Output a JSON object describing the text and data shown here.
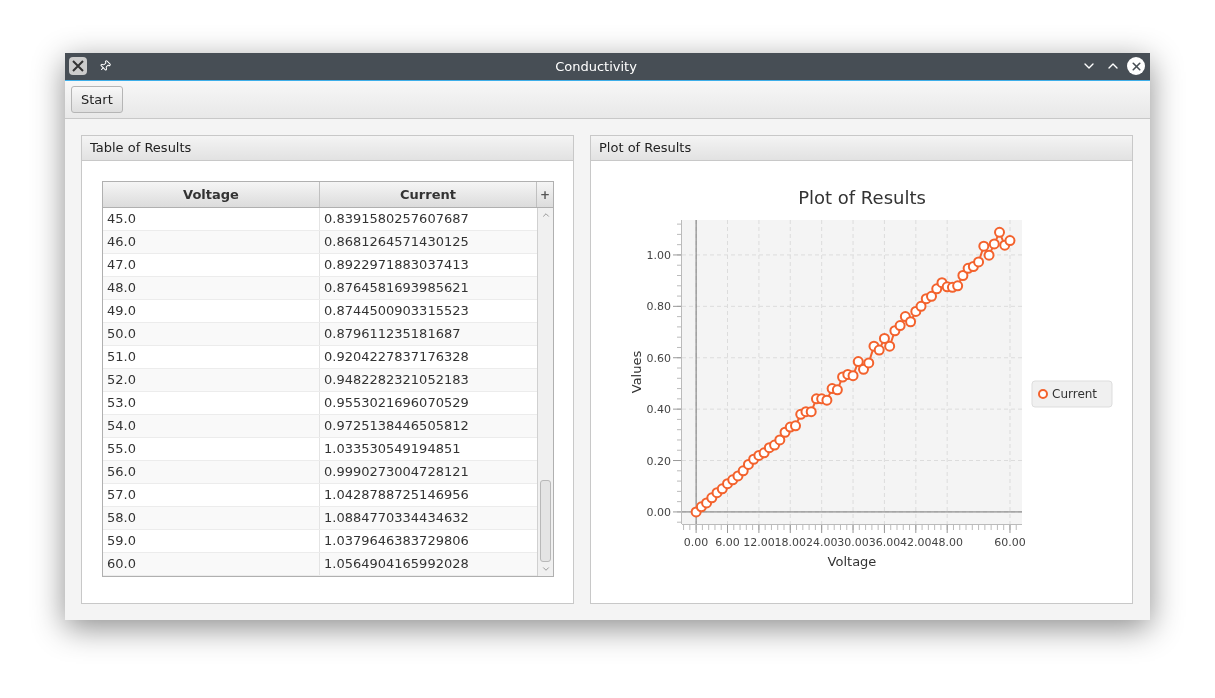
{
  "window": {
    "title": "Conductivity"
  },
  "toolbar": {
    "buttons": [
      "Start"
    ]
  },
  "table_panel": {
    "title": "Table of Results",
    "columns": [
      "Voltage",
      "Current"
    ],
    "column_menu": "+",
    "rows": [
      [
        "45.0",
        "0.8391580257607687"
      ],
      [
        "46.0",
        "0.8681264571430125"
      ],
      [
        "47.0",
        "0.8922971883037413"
      ],
      [
        "48.0",
        "0.8764581693985621"
      ],
      [
        "49.0",
        "0.8744500903315523"
      ],
      [
        "50.0",
        "0.879611235181687"
      ],
      [
        "51.0",
        "0.9204227837176328"
      ],
      [
        "52.0",
        "0.9482282321052183"
      ],
      [
        "53.0",
        "0.9553021696070529"
      ],
      [
        "54.0",
        "0.9725138446505812"
      ],
      [
        "55.0",
        "1.033530549194851"
      ],
      [
        "56.0",
        "0.9990273004728121"
      ],
      [
        "57.0",
        "1.0428788725146956"
      ],
      [
        "58.0",
        "1.0884770334434632"
      ],
      [
        "59.0",
        "1.0379646383729806"
      ],
      [
        "60.0",
        "1.0564904165992028"
      ]
    ]
  },
  "plot_panel": {
    "title": "Plot of Results",
    "chart_data": {
      "type": "line",
      "title": "Plot of Results",
      "xlabel": "Voltage",
      "ylabel": "Values",
      "x": [
        0,
        1,
        2,
        3,
        4,
        5,
        6,
        7,
        8,
        9,
        10,
        11,
        12,
        13,
        14,
        15,
        16,
        17,
        18,
        19,
        20,
        21,
        22,
        23,
        24,
        25,
        26,
        27,
        28,
        29,
        30,
        31,
        32,
        33,
        34,
        35,
        36,
        37,
        38,
        39,
        40,
        41,
        42,
        43,
        44,
        45,
        46,
        47,
        48,
        49,
        50,
        51,
        52,
        53,
        54,
        55,
        56,
        57,
        58,
        59,
        60
      ],
      "grid": true,
      "series": [
        {
          "name": "Current",
          "color": "#f3622d",
          "marker": "circle",
          "values": [
            0.0,
            0.02,
            0.035,
            0.055,
            0.075,
            0.09,
            0.11,
            0.125,
            0.14,
            0.16,
            0.185,
            0.205,
            0.22,
            0.23,
            0.25,
            0.26,
            0.28,
            0.31,
            0.33,
            0.335,
            0.38,
            0.39,
            0.39,
            0.44,
            0.44,
            0.435,
            0.48,
            0.475,
            0.525,
            0.535,
            0.53,
            0.585,
            0.555,
            0.58,
            0.645,
            0.63,
            0.675,
            0.645,
            0.705,
            0.725,
            0.76,
            0.74,
            0.78,
            0.8,
            0.83,
            0.839,
            0.868,
            0.892,
            0.876,
            0.874,
            0.88,
            0.92,
            0.948,
            0.955,
            0.973,
            1.034,
            0.999,
            1.043,
            1.088,
            1.038,
            1.056
          ]
        }
      ],
      "xlim": [
        -2.7,
        62.3
      ],
      "ylim": [
        -0.047,
        1.136
      ],
      "xticks": [
        {
          "value": 0,
          "label": "0.00"
        },
        {
          "value": 6,
          "label": "6.00"
        },
        {
          "value": 12,
          "label": "12.00"
        },
        {
          "value": 18,
          "label": "18.00"
        },
        {
          "value": 24,
          "label": "24.00"
        },
        {
          "value": 30,
          "label": "30.00"
        },
        {
          "value": 36,
          "label": "36.00"
        },
        {
          "value": 42,
          "label": "42.00"
        },
        {
          "value": 48,
          "label": "48.00"
        },
        {
          "value": 60,
          "label": "60.00"
        }
      ],
      "yticks": [
        {
          "value": 0,
          "label": "0.00"
        },
        {
          "value": 0.2,
          "label": "0.20"
        },
        {
          "value": 0.4,
          "label": "0.40"
        },
        {
          "value": 0.6,
          "label": "0.60"
        },
        {
          "value": 0.8,
          "label": "0.80"
        },
        {
          "value": 1,
          "label": "1.00"
        }
      ]
    }
  }
}
